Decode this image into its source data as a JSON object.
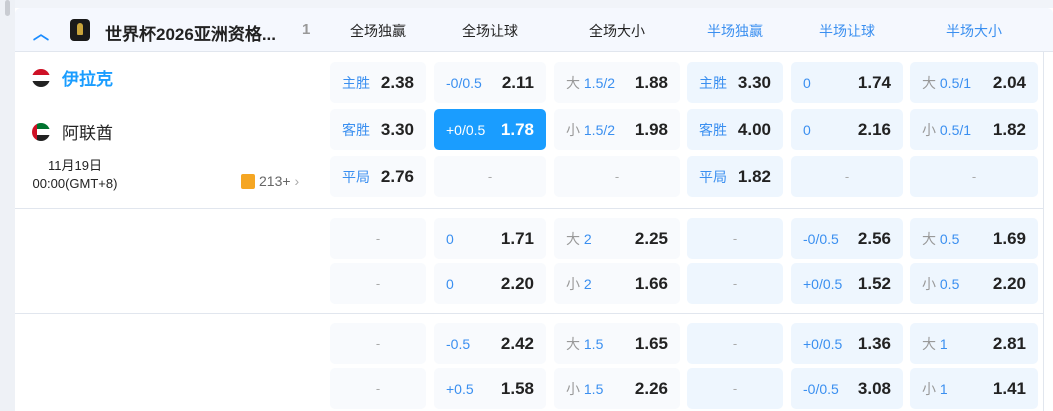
{
  "header": {
    "league": "世界杯2026亚洲资格...",
    "count": "1",
    "columns": [
      {
        "label": "全场独赢",
        "color": "#222222"
      },
      {
        "label": "全场让球",
        "color": "#222222"
      },
      {
        "label": "全场大小",
        "color": "#222222"
      },
      {
        "label": "半场独赢",
        "color": "#3a8ff0"
      },
      {
        "label": "半场让球",
        "color": "#3a8ff0"
      },
      {
        "label": "半场大小",
        "color": "#3a8ff0"
      }
    ]
  },
  "match": {
    "home": "伊拉克",
    "away": "阿联酋",
    "date": "11月19日",
    "time": "00:00(GMT+8)",
    "more": "213+",
    "home_color": "#1a9dff",
    "accent": "#1a9dff"
  },
  "blocks": [
    [
      [
        {
          "lab": "主胜",
          "odds": "2.38"
        },
        {
          "lab": "-0/0.5",
          "odds": "2.11"
        },
        {
          "pre": "大",
          "lab": "1.5/2",
          "odds": "1.88"
        },
        {
          "lab": "主胜",
          "odds": "3.30"
        },
        {
          "lab": "0",
          "odds": "1.74"
        },
        {
          "pre": "大",
          "lab": "0.5/1",
          "odds": "2.04"
        }
      ],
      [
        {
          "lab": "客胜",
          "odds": "3.30"
        },
        {
          "lab": "+0/0.5",
          "odds": "1.78",
          "selected": true
        },
        {
          "pre": "小",
          "lab": "1.5/2",
          "odds": "1.98"
        },
        {
          "lab": "客胜",
          "odds": "4.00"
        },
        {
          "lab": "0",
          "odds": "2.16"
        },
        {
          "pre": "小",
          "lab": "0.5/1",
          "odds": "1.82"
        }
      ],
      [
        {
          "lab": "平局",
          "odds": "2.76"
        },
        {
          "empty": "-"
        },
        {
          "empty": "-"
        },
        {
          "lab": "平局",
          "odds": "1.82"
        },
        {
          "empty": "-"
        },
        {
          "empty": "-"
        }
      ]
    ],
    [
      [
        {
          "empty": "-"
        },
        {
          "lab": "0",
          "odds": "1.71"
        },
        {
          "pre": "大",
          "lab": "2",
          "odds": "2.25"
        },
        {
          "empty": "-"
        },
        {
          "lab": "-0/0.5",
          "odds": "2.56"
        },
        {
          "pre": "大",
          "lab": "0.5",
          "odds": "1.69"
        }
      ],
      [
        {
          "empty": "-"
        },
        {
          "lab": "0",
          "odds": "2.20"
        },
        {
          "pre": "小",
          "lab": "2",
          "odds": "1.66"
        },
        {
          "empty": "-"
        },
        {
          "lab": "+0/0.5",
          "odds": "1.52"
        },
        {
          "pre": "小",
          "lab": "0.5",
          "odds": "2.20"
        }
      ]
    ],
    [
      [
        {
          "empty": "-"
        },
        {
          "lab": "-0.5",
          "odds": "2.42"
        },
        {
          "pre": "大",
          "lab": "1.5",
          "odds": "1.65"
        },
        {
          "empty": "-"
        },
        {
          "lab": "+0/0.5",
          "odds": "1.36"
        },
        {
          "pre": "大",
          "lab": "1",
          "odds": "2.81"
        }
      ],
      [
        {
          "empty": "-"
        },
        {
          "lab": "+0.5",
          "odds": "1.58"
        },
        {
          "pre": "小",
          "lab": "1.5",
          "odds": "2.26"
        },
        {
          "empty": "-"
        },
        {
          "lab": "-0/0.5",
          "odds": "3.08"
        },
        {
          "pre": "小",
          "lab": "1",
          "odds": "1.41"
        }
      ]
    ]
  ]
}
